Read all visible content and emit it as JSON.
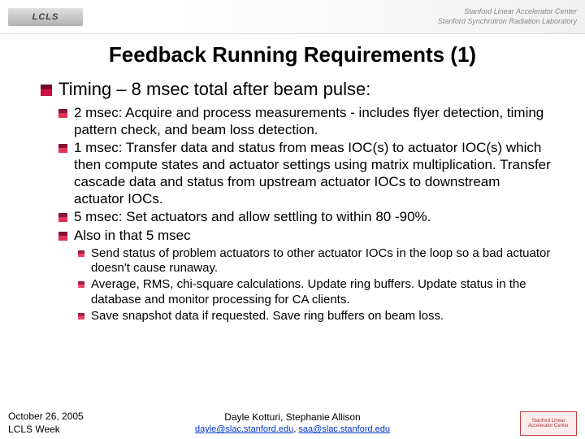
{
  "header": {
    "logo": "LCLS",
    "line1": "Stanford Linear Accelerator Center",
    "line2": "Stanford Synchrotron Radiation Laboratory"
  },
  "title": "Feedback Running Requirements (1)",
  "level1": {
    "text": "Timing – 8 msec total after beam pulse:"
  },
  "level2": [
    {
      "text": "2 msec: Acquire and process measurements - includes flyer detection, timing pattern check, and beam loss detection."
    },
    {
      "text": "1 msec: Transfer data and status from meas IOC(s) to actuator IOC(s) which then compute states and actuator settings using matrix multiplication. Transfer cascade data and status from upstream actuator IOCs to downstream actuator IOCs."
    },
    {
      "text": "5 msec: Set actuators and allow settling to within 80 -90%."
    },
    {
      "text": "Also in that 5 msec"
    }
  ],
  "level3": [
    {
      "text": "Send status of problem actuators to other actuator IOCs in the loop so a bad actuator doesn't cause runaway."
    },
    {
      "text": "Average, RMS, chi-square calculations.  Update ring buffers.  Update status in the database and monitor processing for CA clients."
    },
    {
      "text": "Save snapshot data if requested.  Save ring buffers on beam loss."
    }
  ],
  "footer": {
    "date": "October 26, 2005",
    "event": "LCLS Week",
    "authors": "Dayle Kotturi, Stephanie Allison",
    "email1": "dayle@slac.stanford.edu",
    "email2": "saa@slac.stanford.edu",
    "logo_text": "Stanford Linear Accelerator Center"
  },
  "colors": {
    "bullet_red": "#cc0033",
    "bullet_dark": "#660022"
  }
}
